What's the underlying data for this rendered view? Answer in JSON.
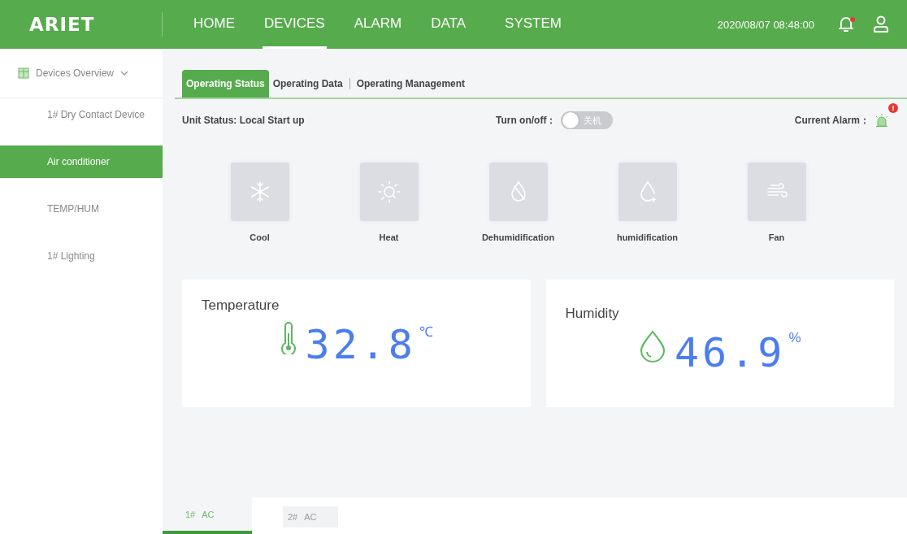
{
  "header": {
    "logo": "ARIET",
    "nav": [
      {
        "label": "HOME",
        "selected": false
      },
      {
        "label": "DEVICES",
        "selected": true
      },
      {
        "label": "ALARM",
        "selected": false
      },
      {
        "label": "DATA",
        "selected": false
      },
      {
        "label": "SYSTEM",
        "selected": false
      }
    ],
    "datetime": "2020/08/07 08:48:00",
    "notification_dot": true
  },
  "sidebar": {
    "group": {
      "label": "Devices Overview",
      "expanded": true
    },
    "items": [
      {
        "label": "1# Dry Contact Device",
        "selected": false
      },
      {
        "label": "Air conditioner",
        "selected": true
      },
      {
        "label": "TEMP/HUM",
        "selected": false
      },
      {
        "label": "1# Lighting",
        "selected": false
      }
    ]
  },
  "tabs": [
    {
      "label": "Operating Status",
      "selected": true
    },
    {
      "label": "Operating Data",
      "selected": false
    },
    {
      "label": "Operating Management",
      "selected": false
    }
  ],
  "status": {
    "unit_status": "Unit Status: Local Start up",
    "power_label": "Turn on/off：",
    "power_switch": {
      "on": false,
      "label": "关机"
    },
    "alarm_label": "Current Alarm：",
    "alarm_badge": "!"
  },
  "modes": [
    {
      "kind": "cool",
      "label": "Cool"
    },
    {
      "kind": "heat",
      "label": "Heat"
    },
    {
      "kind": "dehumidify",
      "label": "Dehumidification"
    },
    {
      "kind": "humidify",
      "label": "humidification"
    },
    {
      "kind": "fan",
      "label": "Fan"
    }
  ],
  "readings": [
    {
      "kind": "temperature",
      "title": "Temperature",
      "value": "32.8",
      "unit": "℃"
    },
    {
      "kind": "humidity",
      "title": "Humidity",
      "value": "46.9",
      "unit": "%"
    }
  ],
  "units": [
    {
      "number": "1#",
      "name": "AC",
      "selected": true
    },
    {
      "number": "2#",
      "name": "AC",
      "selected": false
    }
  ]
}
